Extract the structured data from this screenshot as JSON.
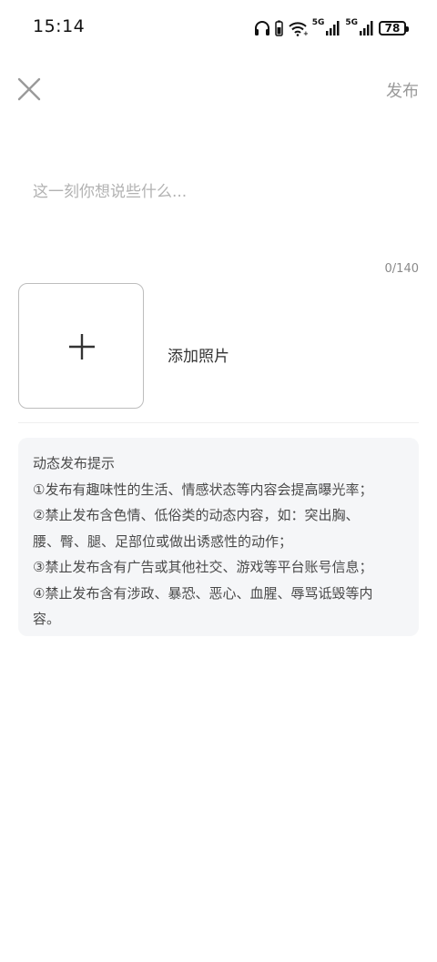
{
  "status_bar": {
    "time": "15:14",
    "network_1": "5G",
    "network_2": "5G",
    "battery": "78",
    "icons": [
      "headphones-icon",
      "phone-battery-icon",
      "wifi-icon",
      "signal-icon",
      "signal-icon",
      "battery-icon"
    ]
  },
  "header": {
    "close_icon": "close-icon",
    "publish_label": "发布"
  },
  "composer": {
    "placeholder": "这一刻你想说些什么...",
    "value": "",
    "char_count": "0/140"
  },
  "photo": {
    "add_icon": "plus-icon",
    "add_label": "添加照片"
  },
  "tips": {
    "title": "动态发布提示",
    "lines": [
      "①发布有趣味性的生活、情感状态等内容会提高曝光率；",
      "②禁止发布含色情、低俗类的动态内容，如：突出胸、",
      "腰、臀、腿、足部位或做出诱惑性的动作；",
      "③禁止发布含有广告或其他社交、游戏等平台账号信息；",
      "④禁止发布含有涉政、暴恐、恶心、血腥、辱骂诋毁等内",
      "容。"
    ]
  },
  "colors": {
    "background": "#ffffff",
    "publish_disabled": "#9a9a9a",
    "placeholder": "#b2b2b2",
    "tips_background": "#f5f6f8"
  }
}
